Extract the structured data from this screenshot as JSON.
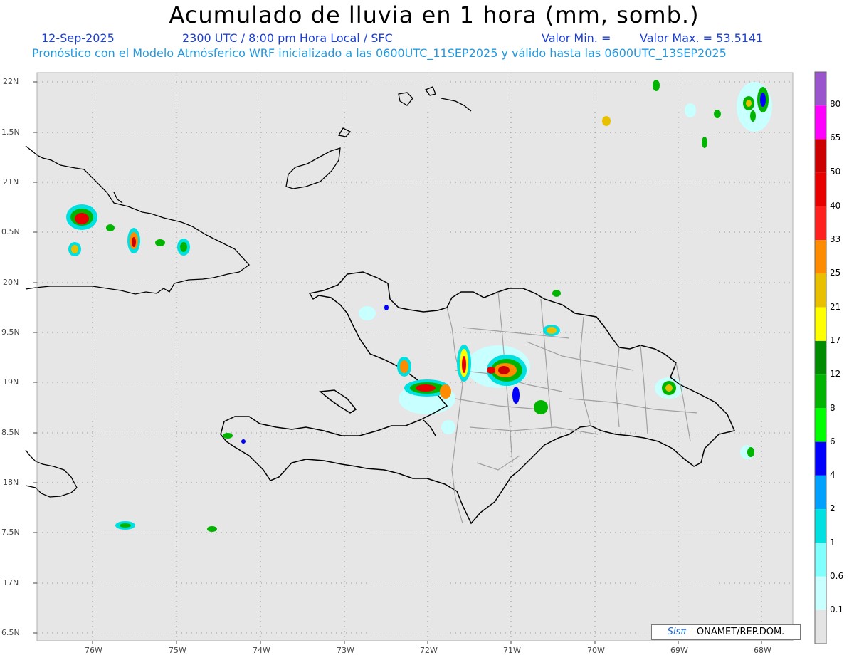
{
  "header": {
    "title": "Acumulado de lluvia en 1 hora (mm, somb.)",
    "date": "12-Sep-2025",
    "time": "2300 UTC / 8:00 pm Hora Local / SFC",
    "valor_min": "Valor Min. =",
    "valor_max": "Valor Max. = 53.5141",
    "model_line": "Pronóstico con el Modelo Atmósferico WRF inicializado a las 0600UTC_11SEP2025 y válido hasta las  0600UTC_13SEP2025"
  },
  "axes": {
    "lat_labels": [
      "22N",
      "1.5N",
      "21N",
      "0.5N",
      "20N",
      "9.5N",
      "19N",
      "8.5N",
      "18N",
      "7.5N",
      "17N",
      "6.5N"
    ],
    "lon_labels": [
      "76W",
      "75W",
      "74W",
      "73W",
      "72W",
      "71W",
      "70W",
      "69W",
      "68W"
    ]
  },
  "colorbar": {
    "labels": [
      "80",
      "65",
      "50",
      "40",
      "33",
      "25",
      "21",
      "17",
      "12",
      "8",
      "6",
      "4",
      "2",
      "1",
      "0.6",
      "0.1"
    ],
    "colors": [
      "#9b55cc",
      "#ff00ff",
      "#cc0000",
      "#e80000",
      "#ff2020",
      "#ff8c00",
      "#e8c000",
      "#ffff00",
      "#008c00",
      "#00b400",
      "#00ff00",
      "#0000ff",
      "#00a0ff",
      "#00e0e0",
      "#80ffff",
      "#c8ffff",
      "#e4e4e4"
    ]
  },
  "credit": {
    "logo": "Sisπ",
    "text": " – ONAMET/REP.DOM."
  }
}
